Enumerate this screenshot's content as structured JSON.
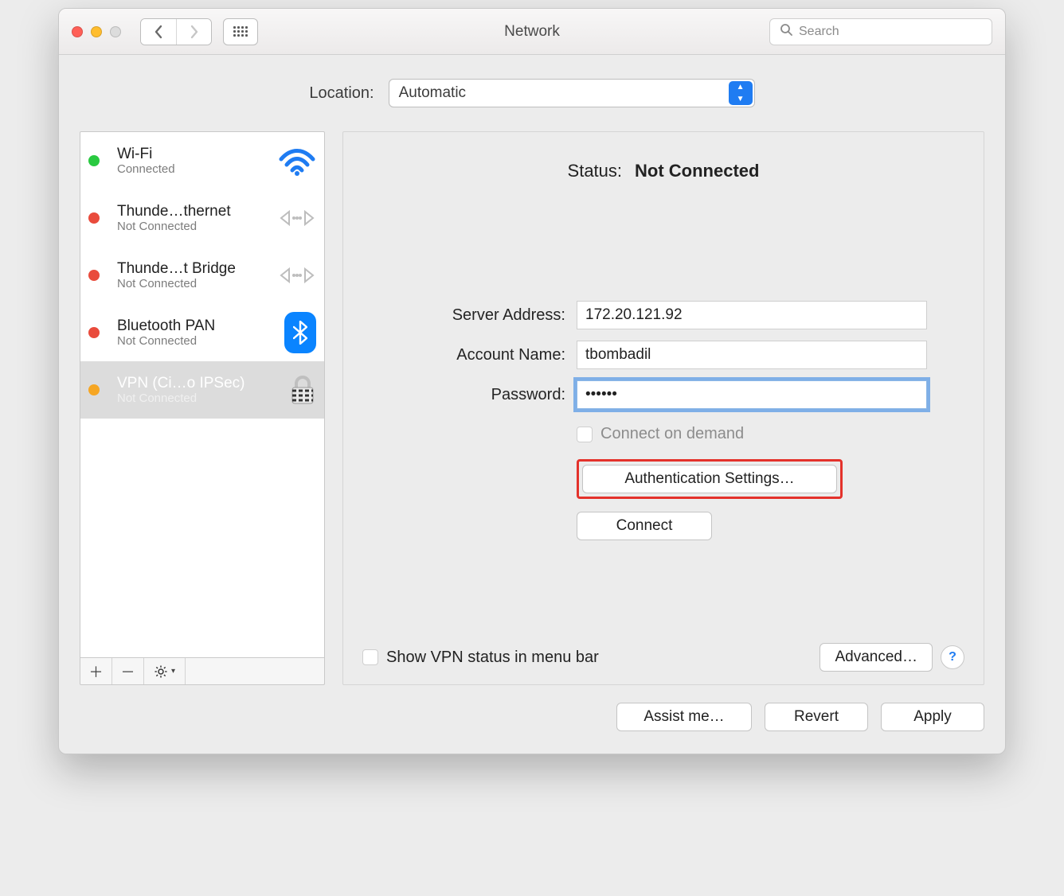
{
  "window": {
    "title": "Network"
  },
  "toolbar": {
    "search_placeholder": "Search"
  },
  "location": {
    "label": "Location:",
    "value": "Automatic"
  },
  "sidebar": {
    "items": [
      {
        "name": "Wi-Fi",
        "status": "Connected",
        "dot": "green",
        "icon": "wifi"
      },
      {
        "name": "Thunde…thernet",
        "status": "Not Connected",
        "dot": "red",
        "icon": "ethernet"
      },
      {
        "name": "Thunde…t Bridge",
        "status": "Not Connected",
        "dot": "red",
        "icon": "ethernet"
      },
      {
        "name": "Bluetooth PAN",
        "status": "Not Connected",
        "dot": "red",
        "icon": "bluetooth"
      },
      {
        "name": "VPN (Ci…o IPSec)",
        "status": "Not Connected",
        "dot": "amber",
        "icon": "lock",
        "selected": true
      }
    ]
  },
  "detail": {
    "status_label": "Status:",
    "status_value": "Not Connected",
    "fields": {
      "server_label": "Server Address:",
      "server_value": "172.20.121.92",
      "account_label": "Account Name:",
      "account_value": "tbombadil",
      "password_label": "Password:",
      "password_value": "••••••",
      "connect_on_demand_label": "Connect on demand"
    },
    "buttons": {
      "auth_settings": "Authentication Settings…",
      "connect": "Connect",
      "advanced": "Advanced…"
    },
    "show_vpn_label": "Show VPN status in menu bar",
    "help": "?"
  },
  "bottom": {
    "assist": "Assist me…",
    "revert": "Revert",
    "apply": "Apply"
  }
}
